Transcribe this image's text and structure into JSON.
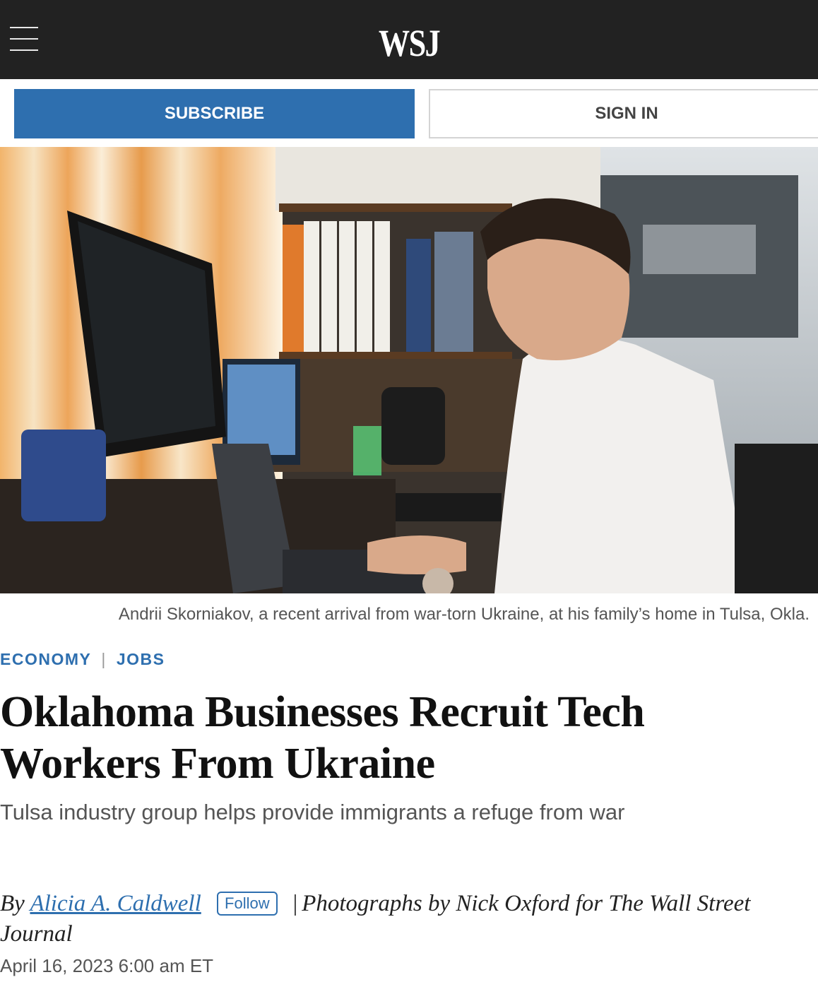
{
  "header": {
    "logo": "WSJ",
    "menu_icon": "hamburger-menu-icon"
  },
  "actions": {
    "subscribe_label": "SUBSCRIBE",
    "signin_label": "SIGN IN"
  },
  "photo": {
    "caption": "Andrii Skorniakov, a recent arrival from war-torn Ukraine, at his family’s home in Tulsa, Okla."
  },
  "article": {
    "sections": [
      "ECONOMY",
      "JOBS"
    ],
    "section_separator": "|",
    "headline": "Oklahoma Businesses Recruit Tech Workers From Ukraine",
    "dek": "Tulsa industry group helps provide immigrants a refuge from war",
    "byline_prefix": "By",
    "author": "Alicia A. Caldwell",
    "follow_label": "Follow",
    "byline_separator": "|",
    "photo_credit": "Photographs by Nick Oxford for The Wall Street Journal",
    "date": "April 16, 2023 6:00 am ET"
  },
  "colors": {
    "topbar": "#222222",
    "accent_blue": "#2e6faf",
    "caption_gray": "#555555"
  }
}
